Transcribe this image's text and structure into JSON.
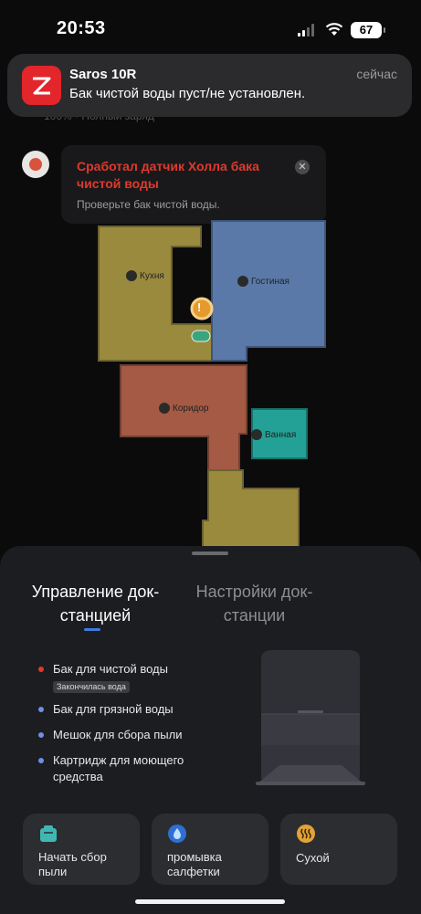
{
  "status_bar": {
    "time": "20:53",
    "battery": "67",
    "signal_icon": "cellular-signal-icon",
    "wifi_icon": "wifi-icon"
  },
  "notification": {
    "app_name": "Saros 10R",
    "message": "Бак чистой воды пуст/не установлен.",
    "time": "сейчас",
    "partial_under_text": "100% · Полный заряд",
    "app_icon_color": "#e3262b"
  },
  "alert": {
    "title": "Сработал датчик Холла бака чистой воды",
    "subtitle": "Проверьте бак чистой воды.",
    "close_symbol": "✕",
    "title_color": "#e0392d"
  },
  "map": {
    "rooms": [
      {
        "name": "Кухня",
        "color": "#9a8a3e"
      },
      {
        "name": "Гостиная",
        "color": "#5a79a8"
      },
      {
        "name": "Коридор",
        "color": "#a45a44"
      },
      {
        "name": "Ванная",
        "color": "#24a197"
      }
    ],
    "warning_symbol": "!"
  },
  "sheet": {
    "tabs": [
      {
        "label": "Управление док-станцией",
        "active": true
      },
      {
        "label": "Настройки док-станции",
        "active": false
      }
    ],
    "status_items": [
      {
        "label": "Бак для чистой воды",
        "badge": "Закончилась вода",
        "dot_color": "#e0392d"
      },
      {
        "label": "Бак для грязной воды",
        "dot_color": "#6f8ee6"
      },
      {
        "label": "Мешок для сбора пыли",
        "dot_color": "#6f8ee6"
      },
      {
        "label": "Картридж для моющего средства",
        "dot_color": "#6f8ee6"
      }
    ],
    "actions": [
      {
        "label": "Начать сбор пыли",
        "icon": "dust-bin-icon"
      },
      {
        "label": "промывка салфетки",
        "icon": "water-drop-icon"
      },
      {
        "label": "Сухой",
        "icon": "heat-waves-icon"
      }
    ]
  }
}
